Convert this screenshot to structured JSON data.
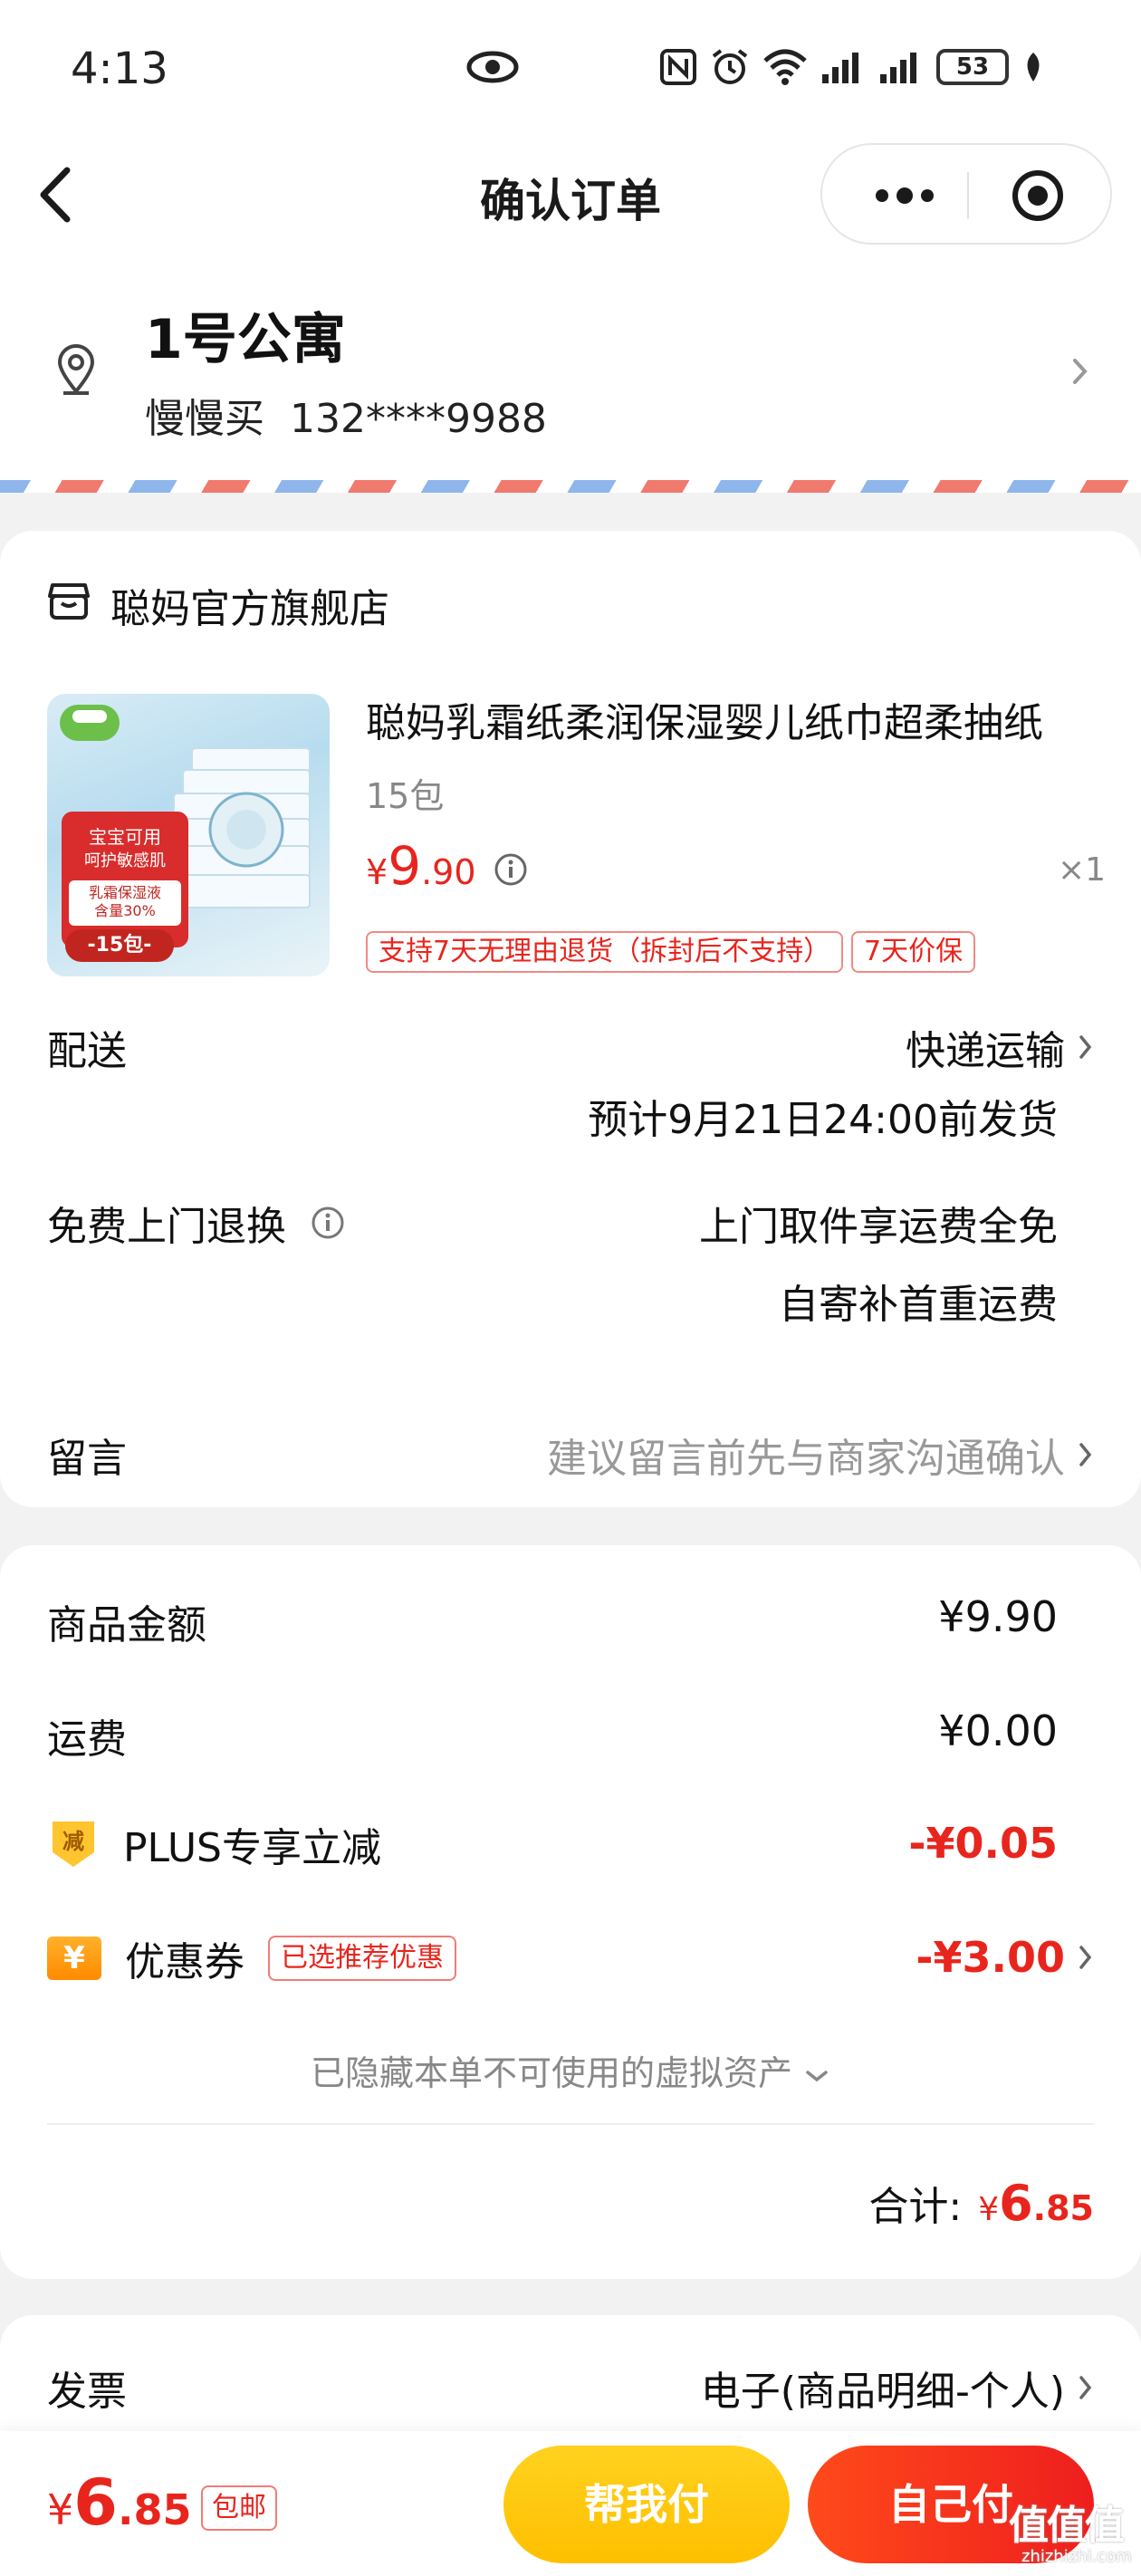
{
  "status_bar": {
    "time": "4:13",
    "battery": "53",
    "icons": [
      "eye-icon",
      "nfc-icon",
      "alarm-icon",
      "wifi-icon",
      "signal-icon",
      "signal-icon",
      "battery-icon",
      "leaf-icon"
    ]
  },
  "header": {
    "title": "确认订单"
  },
  "address": {
    "name": "1号公寓",
    "contact": "慢慢买  132****9988"
  },
  "store": {
    "name": "聪妈官方旗舰店",
    "product": {
      "title": "聪妈乳霜纸柔润保湿婴儿纸巾超柔抽纸",
      "spec": "15包",
      "price_symbol": "¥",
      "price_int": "9",
      "price_dec": ".90",
      "quantity": "×1",
      "image_text": {
        "line1": "宝宝可用",
        "line2": "呵护敏感肌",
        "line3a": "乳霜保湿液",
        "line3b": "含量30%",
        "line4": "-15包-"
      },
      "tags": [
        "支持7天无理由退货（拆封后不支持）",
        "7天价保"
      ]
    },
    "delivery": {
      "label": "配送",
      "method": "快递运输",
      "eta": "预计9月21日24:00前发货"
    },
    "return": {
      "label": "免费上门退换",
      "line1": "上门取件享运费全免",
      "line2": "自寄补首重运费"
    },
    "message": {
      "label": "留言",
      "placeholder": "建议留言前先与商家沟通确认"
    }
  },
  "summary": {
    "goods_label": "商品金额",
    "goods_value": "¥9.90",
    "shipping_label": "运费",
    "shipping_value": "¥0.00",
    "plus_badge": "减",
    "plus_label": "PLUS专享立减",
    "plus_value": "-¥0.05",
    "coupon_badge": "¥",
    "coupon_label": "优惠券",
    "coupon_tag": "已选推荐优惠",
    "coupon_value": "-¥3.00",
    "hidden_assets": "已隐藏本单不可使用的虚拟资产",
    "total_label": "合计:",
    "total_symbol": "¥",
    "total_int": "6",
    "total_dec": ".85"
  },
  "invoice": {
    "label": "发票",
    "value": "电子(商品明细-个人)"
  },
  "bottom_bar": {
    "price_symbol": "¥",
    "price_int": "6",
    "price_dec": ".85",
    "shipping_tag": "包邮",
    "help_pay": "帮我付",
    "self_pay": "自己付"
  },
  "watermark": {
    "main": "值值值",
    "sub": "zhizhizhi.com"
  },
  "colors": {
    "accent_red": "#e8251d",
    "help_button": "#ffc400",
    "self_button": "#f3321e"
  }
}
